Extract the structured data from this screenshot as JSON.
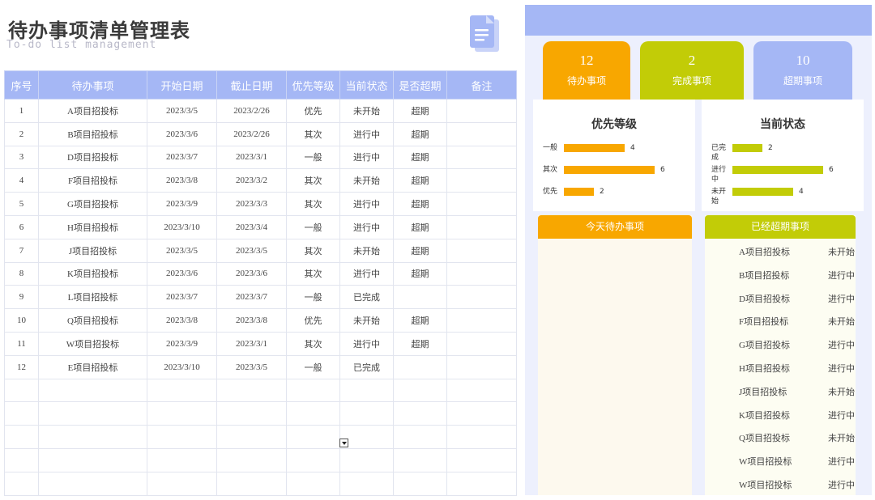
{
  "header": {
    "title": "待办事项清单管理表",
    "subtitle": "To-do list management"
  },
  "table": {
    "columns": [
      "序号",
      "待办事项",
      "开始日期",
      "截止日期",
      "优先等级",
      "当前状态",
      "是否超期",
      "备注"
    ],
    "rows": [
      [
        "1",
        "A项目招投标",
        "2023/3/5",
        "2023/2/26",
        "优先",
        "未开始",
        "超期",
        ""
      ],
      [
        "2",
        "B项目招投标",
        "2023/3/6",
        "2023/2/26",
        "其次",
        "进行中",
        "超期",
        ""
      ],
      [
        "3",
        "D项目招投标",
        "2023/3/7",
        "2023/3/1",
        "一般",
        "进行中",
        "超期",
        ""
      ],
      [
        "4",
        "F项目招投标",
        "2023/3/8",
        "2023/3/2",
        "其次",
        "未开始",
        "超期",
        ""
      ],
      [
        "5",
        "G项目招投标",
        "2023/3/9",
        "2023/3/3",
        "其次",
        "进行中",
        "超期",
        ""
      ],
      [
        "6",
        "H项目招投标",
        "2023/3/10",
        "2023/3/4",
        "一般",
        "进行中",
        "超期",
        ""
      ],
      [
        "7",
        "J项目招投标",
        "2023/3/5",
        "2023/3/5",
        "其次",
        "未开始",
        "超期",
        ""
      ],
      [
        "8",
        "K项目招投标",
        "2023/3/6",
        "2023/3/6",
        "其次",
        "进行中",
        "超期",
        ""
      ],
      [
        "9",
        "L项目招投标",
        "2023/3/7",
        "2023/3/7",
        "一般",
        "已完成",
        "",
        ""
      ],
      [
        "10",
        "Q项目招投标",
        "2023/3/8",
        "2023/3/8",
        "优先",
        "未开始",
        "超期",
        ""
      ],
      [
        "11",
        "W项目招投标",
        "2023/3/9",
        "2023/3/1",
        "其次",
        "进行中",
        "超期",
        ""
      ],
      [
        "12",
        "E项目招投标",
        "2023/3/10",
        "2023/3/5",
        "一般",
        "已完成",
        "",
        ""
      ]
    ],
    "empty_rows": 5
  },
  "summary": {
    "todo": {
      "count": "12",
      "label": "待办事项"
    },
    "done": {
      "count": "2",
      "label": "完成事项"
    },
    "overdue": {
      "count": "10",
      "label": "超期事项"
    }
  },
  "priority_chart": {
    "title": "优先等级",
    "max": 6,
    "items": [
      {
        "label": "一般",
        "value": 4
      },
      {
        "label": "其次",
        "value": 6
      },
      {
        "label": "优先",
        "value": 2
      }
    ]
  },
  "status_chart": {
    "title": "当前状态",
    "max": 6,
    "items": [
      {
        "label": "已完成",
        "value": 2
      },
      {
        "label": "进行中",
        "value": 6
      },
      {
        "label": "未开始",
        "value": 4
      }
    ]
  },
  "today_list": {
    "title": "今天待办事项",
    "items": []
  },
  "overdue_list": {
    "title": "已经超期事项",
    "items": [
      {
        "name": "A项目招投标",
        "status": "未开始"
      },
      {
        "name": "B项目招投标",
        "status": "进行中"
      },
      {
        "name": "D项目招投标",
        "status": "进行中"
      },
      {
        "name": "F项目招投标",
        "status": "未开始"
      },
      {
        "name": "G项目招投标",
        "status": "进行中"
      },
      {
        "name": "H项目招投标",
        "status": "进行中"
      },
      {
        "name": "J项目招投标",
        "status": "未开始"
      },
      {
        "name": "K项目招投标",
        "status": "进行中"
      },
      {
        "name": "Q项目招投标",
        "status": "未开始"
      },
      {
        "name": "W项目招投标",
        "status": "进行中"
      },
      {
        "name": "W项目招投标",
        "status": "进行中"
      }
    ]
  },
  "colors": {
    "accent_blue": "#a5b7f5",
    "accent_orange": "#f8a700",
    "accent_green": "#c2cc07"
  }
}
